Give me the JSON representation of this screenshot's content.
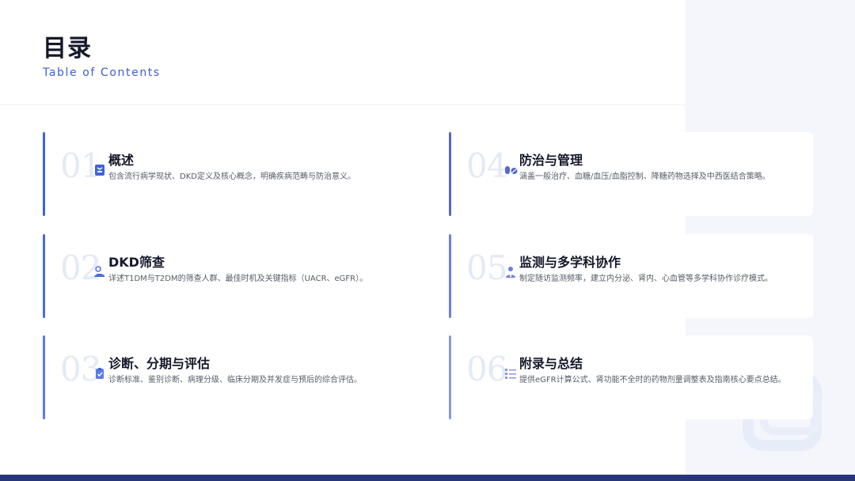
{
  "header": {
    "title": "目录",
    "subtitle": "Table of Contents"
  },
  "colors": {
    "accent_primary": "#3b5fd0",
    "accent_card_1": "#3e64d8",
    "accent_card_2": "#4a6ce0",
    "accent_card_3": "#5a7be6",
    "accent_card_4": "#5865d0",
    "accent_card_5": "#6d7fe0",
    "accent_card_6": "#8a96e6",
    "bottom_bar": "#27357a"
  },
  "sections": [
    {
      "number": "01",
      "title": "概述",
      "description": "包含流行病学现状、DKD定义及核心概念，明确疾病范畴与防治意义。",
      "icon": "notebook-icon"
    },
    {
      "number": "02",
      "title": "DKD筛查",
      "description": "详述T1DM与T2DM的筛查人群、最佳时机及关键指标（UACR、eGFR）。",
      "icon": "hand-dollar-icon"
    },
    {
      "number": "03",
      "title": "诊断、分期与评估",
      "description": "诊断标准、鉴别诊断、病理分级、临床分期及并发症与预后的综合评估。",
      "icon": "clipboard-check-icon"
    },
    {
      "number": "04",
      "title": "防治与管理",
      "description": "涵盖一般治疗、血糖/血压/血脂控制、降糖药物选择及中西医结合策略。",
      "icon": "pills-icon"
    },
    {
      "number": "05",
      "title": "监测与多学科协作",
      "description": "制定随访监测频率，建立内分泌、肾内、心血管等多学科协作诊疗模式。",
      "icon": "doctor-icon"
    },
    {
      "number": "06",
      "title": "附录与总结",
      "description": "提供eGFR计算公式、肾功能不全时的药物剂量调整表及指南核心要点总结。",
      "icon": "list-icon"
    }
  ]
}
